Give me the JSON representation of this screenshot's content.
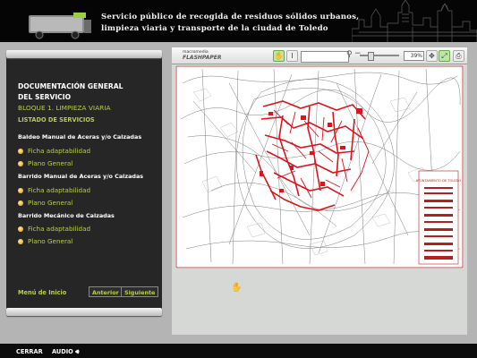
{
  "header": {
    "title_line1": "Servicio público de recogida de residuos sólidos urbanos,",
    "title_line2": "limpieza viaria y transporte de la ciudad de Toledo"
  },
  "sidebar": {
    "doc_title_line1": "DOCUMENTACIÓN GENERAL",
    "doc_title_line2": "DEL SERVICIO",
    "bloque": "BLOQUE 1. LIMPIEZA VIARIA",
    "listado": "LISTADO DE SERVICIOS",
    "sections": [
      {
        "title": "Baldeo Manual de Aceras y/o Calzadas",
        "links": [
          "Ficha adaptabilidad",
          "Plano General"
        ]
      },
      {
        "title": "Barrido Manual de Aceras y/o Calzadas",
        "links": [
          "Ficha adaptabilidad",
          "Plano General"
        ]
      },
      {
        "title": "Barrido Mecánico de Calzadas",
        "links": [
          "Ficha adaptabilidad",
          "Plano General"
        ]
      }
    ],
    "menu_inicio": "Menú de Inicio",
    "anterior": "Anterior",
    "siguiente": "Siguiente"
  },
  "viewer": {
    "logo_top": "macromedia",
    "logo_bottom": "FLASHPAPER",
    "zoom": "39%",
    "search_value": "",
    "icons": [
      "hand-tool-icon",
      "text-select-icon",
      "search-icon",
      "zoom-out-icon",
      "zoom-in-icon",
      "fit-page-icon",
      "fit-width-icon",
      "print-icon"
    ],
    "map_legend_title": "AYUNTAMIENTO DE TOLEDO"
  },
  "footer": {
    "cerrar": "CERRAR",
    "audio": "AUDIO"
  },
  "colors": {
    "accent_green": "#b6d04a",
    "route_red": "#e0131b",
    "panel_dark": "#262626"
  }
}
